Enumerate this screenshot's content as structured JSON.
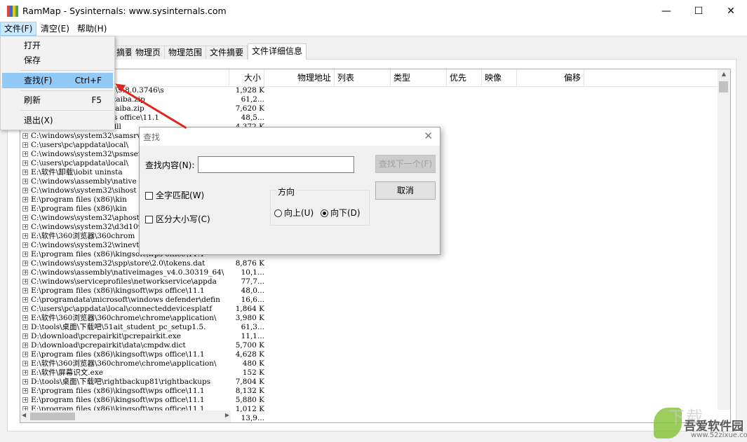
{
  "window": {
    "title": "RamMap - Sysinternals: www.sysinternals.com",
    "icon_colors": [
      "#e8403a",
      "#2d6fd8",
      "#f2c21b",
      "#4aa83f"
    ],
    "minimize": "—",
    "maximize": "☐",
    "close": "✕"
  },
  "menubar": {
    "items": [
      {
        "label": "文件(F)"
      },
      {
        "label": "清空(E)"
      },
      {
        "label": "帮助(H)"
      }
    ]
  },
  "file_menu": {
    "items": [
      {
        "label": "打开",
        "shortcut": ""
      },
      {
        "label": "保存",
        "shortcut": ""
      },
      {
        "label": "查找(F)",
        "shortcut": "Ctrl+F"
      },
      {
        "label": "刷新",
        "shortcut": "F5"
      },
      {
        "label": "退出(X)",
        "shortcut": ""
      }
    ]
  },
  "tabs": [
    {
      "label": "摘要"
    },
    {
      "label": "物理页"
    },
    {
      "label": "物理范围"
    },
    {
      "label": "文件摘要"
    },
    {
      "label": "文件详细信息"
    }
  ],
  "columns": [
    {
      "label": "大小"
    },
    {
      "label": "物理地址"
    },
    {
      "label": "列表"
    },
    {
      "label": "类型"
    },
    {
      "label": "优先"
    },
    {
      "label": "映像"
    },
    {
      "label": "偏移"
    }
  ],
  "rows": [
    {
      "path": "C:\\...(x86)\\sogoupinyin\\9.8.0.3746\\s",
      "size": "1,928 K"
    },
    {
      "path": "E:\\...\\aitstudentpc_xiazaiba.zip",
      "size": "61,2..."
    },
    {
      "path": "D:\\...\\rightbackup_xiazaiba.zip",
      "size": "7,620 K"
    },
    {
      "path": "E:\\...(x86)\\kingsoft\\wps office\\11.1",
      "size": "48,5..."
    },
    {
      "path": "E:\\...\\kit\\debughelper.dll",
      "size": "4,372 K"
    },
    {
      "path": "C:\\windows\\system32\\samsrv.dll",
      "size": ""
    },
    {
      "path": "C:\\users\\pc\\appdata\\local\\",
      "size": ""
    },
    {
      "path": "C:\\windows\\system32\\psmserv",
      "size": ""
    },
    {
      "path": "C:\\users\\pc\\appdata\\local\\",
      "size": ""
    },
    {
      "path": "E:\\软件\\卸载\\iobit uninsta",
      "size": ""
    },
    {
      "path": "C:\\windows\\assembly\\native",
      "size": ""
    },
    {
      "path": "C:\\windows\\system32\\sihost",
      "size": ""
    },
    {
      "path": "E:\\program files (x86)\\kin",
      "size": ""
    },
    {
      "path": "E:\\program files (x86)\\kin",
      "size": ""
    },
    {
      "path": "C:\\windows\\system32\\aphost",
      "size": ""
    },
    {
      "path": "C:\\windows\\system32\\d3d10w",
      "size": ""
    },
    {
      "path": "E:\\软件\\360浏览器\\360chrom",
      "size": ""
    },
    {
      "path": "C:\\windows\\system32\\winevt",
      "size": ""
    },
    {
      "path": "E:\\program files (x86)\\kingsoft\\wps office\\11.1",
      "size": ""
    },
    {
      "path": "C:\\windows\\system32\\spp\\store\\2.0\\tokens.dat",
      "size": "8,876 K"
    },
    {
      "path": "C:\\windows\\assembly\\nativeimages_v4.0.30319_64\\",
      "size": "10,1..."
    },
    {
      "path": "C:\\windows\\serviceprofiles\\networkservice\\appda",
      "size": "77,7..."
    },
    {
      "path": "E:\\program files (x86)\\kingsoft\\wps office\\11.1",
      "size": "48,0..."
    },
    {
      "path": "C:\\programdata\\microsoft\\windows defender\\defin",
      "size": "16,6..."
    },
    {
      "path": "C:\\users\\pc\\appdata\\local\\connecteddevicesplatf",
      "size": "1,864 K"
    },
    {
      "path": "E:\\软件\\360浏览器\\360chrome\\chrome\\application\\",
      "size": "3,980 K"
    },
    {
      "path": "D:\\tools\\桌面\\下载吧\\51ait_student_pc_setup1.5.",
      "size": "61,3..."
    },
    {
      "path": "D:\\download\\pcrepairkit\\pcrepairkit.exe",
      "size": "11,1..."
    },
    {
      "path": "D:\\download\\pcrepairkit\\data\\cmpdw.dict",
      "size": "5,700 K"
    },
    {
      "path": "E:\\program files (x86)\\kingsoft\\wps office\\11.1",
      "size": "4,628 K"
    },
    {
      "path": "E:\\软件\\360浏览器\\360chrome\\chrome\\application\\",
      "size": "480 K"
    },
    {
      "path": "E:\\软件\\屏幕识文.exe",
      "size": "152 K"
    },
    {
      "path": "D:\\tools\\桌面\\下载吧\\rightbackup81\\rightbackups",
      "size": "7,804 K"
    },
    {
      "path": "E:\\program files (x86)\\kingsoft\\wps office\\11.1",
      "size": "8,132 K"
    },
    {
      "path": "E:\\program files (x86)\\kingsoft\\wps office\\11.1",
      "size": "5,880 K"
    },
    {
      "path": "E:\\program files (x86)\\kingsoft\\wps office\\11.1",
      "size": "1,012 K"
    },
    {
      "path": "",
      "size": "13,9..."
    }
  ],
  "find_dialog": {
    "title": "查找",
    "find_label": "查找内容(N):",
    "find_value": "",
    "find_next": "查找下一个(F)",
    "cancel": "取消",
    "match_whole": "全字匹配(W)",
    "match_case": "区分大小写(C)",
    "direction_title": "方向",
    "dir_up": "向上(U)",
    "dir_down": "向下(D)",
    "selected_direction": "down"
  },
  "watermark": {
    "text": "吾爱软件园",
    "url": "www.52zixue.com",
    "top": "下载"
  },
  "accent_color": "#91c9f7",
  "arrow_color": "#e0261f"
}
